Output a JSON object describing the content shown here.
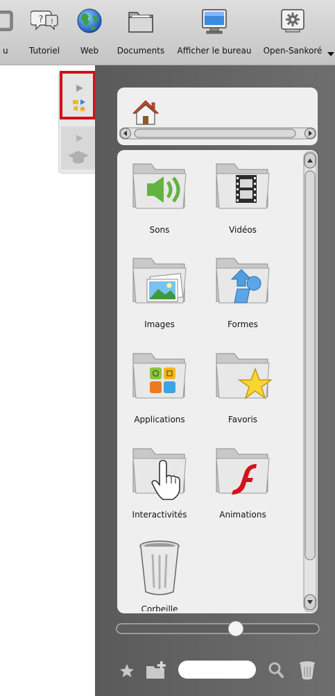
{
  "toolbar": {
    "partial_label": "u",
    "items": [
      {
        "label": "Tutoriel",
        "icon": "tutorial-icon"
      },
      {
        "label": "Web",
        "icon": "web-globe-icon"
      },
      {
        "label": "Documents",
        "icon": "documents-folder-icon"
      },
      {
        "label": "Afficher le bureau",
        "icon": "show-desktop-icon"
      },
      {
        "label": "Open-Sankoré",
        "icon": "open-sankore-gear-icon"
      }
    ],
    "dropdown_icon": "chevron-down-icon"
  },
  "left_tabs": [
    {
      "name": "library-tab",
      "icon": "library-icon",
      "selected": true
    },
    {
      "name": "teacher-tab",
      "icon": "graduation-cap-icon",
      "selected": false
    }
  ],
  "library": {
    "home_icon": "home-icon",
    "folders": [
      {
        "label": "Sons",
        "icon": "sounds-speaker-icon"
      },
      {
        "label": "Vidéos",
        "icon": "videos-film-icon"
      },
      {
        "label": "Images",
        "icon": "images-picture-icon"
      },
      {
        "label": "Formes",
        "icon": "shapes-icon"
      },
      {
        "label": "Applications",
        "icon": "applications-icon"
      },
      {
        "label": "Favoris",
        "icon": "favorites-star-icon"
      },
      {
        "label": "Interactivités",
        "icon": "interactivities-hand-icon"
      },
      {
        "label": "Animations",
        "icon": "animations-flash-icon"
      },
      {
        "label": "Corbeille",
        "icon": "trash-bin-icon"
      }
    ]
  },
  "bottom": {
    "search_placeholder": "",
    "search_value": ""
  },
  "colors": {
    "toolbar_bg": "#d6d6d6",
    "panel_bg": "#636363",
    "box_bg": "#efefef",
    "highlight": "#d0101a"
  }
}
